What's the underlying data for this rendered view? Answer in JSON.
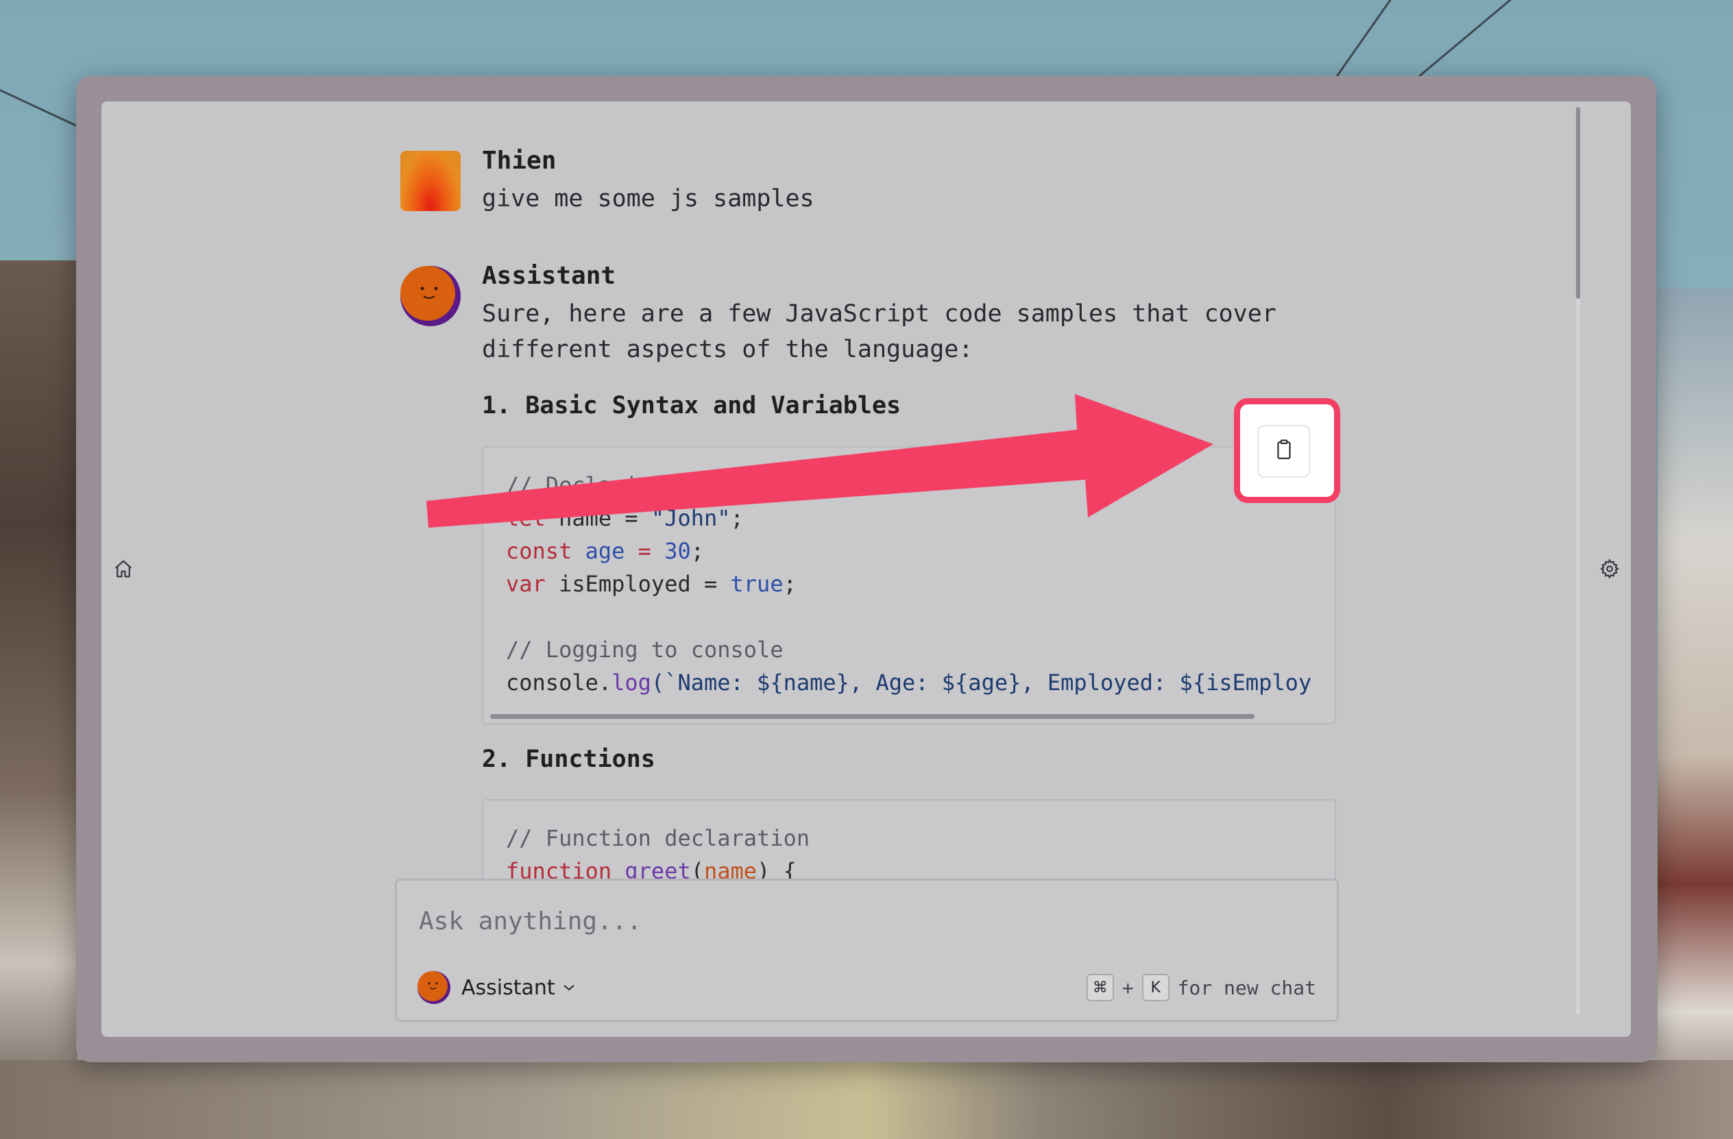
{
  "conversation": {
    "user": {
      "name": "Thien",
      "message": "give me some js samples"
    },
    "assistant": {
      "name": "Assistant",
      "intro": "Sure, here are a few JavaScript code samples that cover different aspects of the language:",
      "sections": [
        {
          "heading": "1. Basic Syntax and Variables"
        },
        {
          "heading": "2. Functions"
        }
      ]
    }
  },
  "code1": {
    "line1": "// Declaring variables",
    "line2_kw": "let",
    "line2_rest": " name = ",
    "line2_str": "\"John\"",
    "line2_end": ";",
    "line3_kw": "const",
    "line3_var": " age",
    "line3_op": " = ",
    "line3_num": "30",
    "line3_end": ";",
    "line4_kw": "var",
    "line4_rest": " isEmployed = ",
    "line4_bool": "true",
    "line4_end": ";",
    "line5": "// Logging to console",
    "line6_a": "console.",
    "line6_fn": "log",
    "line6_b": "(`Name: ${name}, Age: ${age}, Employed: ${isEmploy"
  },
  "code2": {
    "line1": "// Function declaration",
    "line2_kw": "function",
    "line2_fn": " greet",
    "line2_p1": "(",
    "line2_param": "name",
    "line2_p2": ") {"
  },
  "copy_button": {
    "icon": "clipboard-icon"
  },
  "input": {
    "placeholder": "Ask anything...",
    "assistant_label": "Assistant",
    "shortcut_key1": "⌘",
    "shortcut_plus": "+",
    "shortcut_key2": "K",
    "shortcut_text": "for new chat"
  },
  "sidebar": {
    "home_icon": "home-icon",
    "settings_icon": "gear-icon"
  },
  "colors": {
    "highlight": "#f43f65",
    "accent": "#d9600f"
  }
}
